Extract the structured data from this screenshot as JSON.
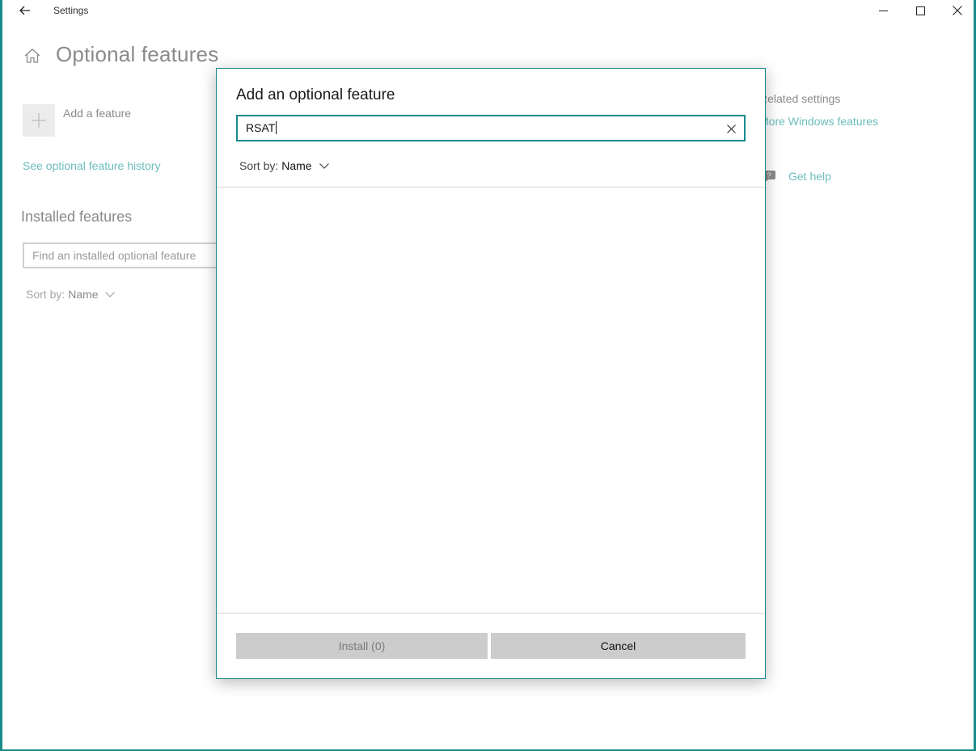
{
  "window": {
    "app_title": "Settings",
    "controls": [
      "minimize",
      "maximize",
      "close"
    ],
    "accent_color": "#1a8a8a",
    "link_color": "#6cbcbc"
  },
  "page": {
    "title": "Optional features",
    "add_feature_label": "Add a feature",
    "history_link": "See optional feature history",
    "installed_title": "Installed features",
    "find_placeholder": "Find an installed optional feature",
    "sort": {
      "label": "Sort by:",
      "value": "Name"
    }
  },
  "related": {
    "title": "Related settings",
    "more_link": "More Windows features",
    "help_label": "Get help"
  },
  "dialog": {
    "title": "Add an optional feature",
    "search_value": "RSAT",
    "sort": {
      "label": "Sort by:",
      "value": "Name"
    },
    "install_label": "Install (0)",
    "cancel_label": "Cancel"
  },
  "icons": {
    "back": "back-arrow-icon",
    "home": "home-icon",
    "plus": "plus-icon",
    "clear": "close-icon",
    "chevron": "chevron-down-icon",
    "help": "help-chat-icon"
  }
}
